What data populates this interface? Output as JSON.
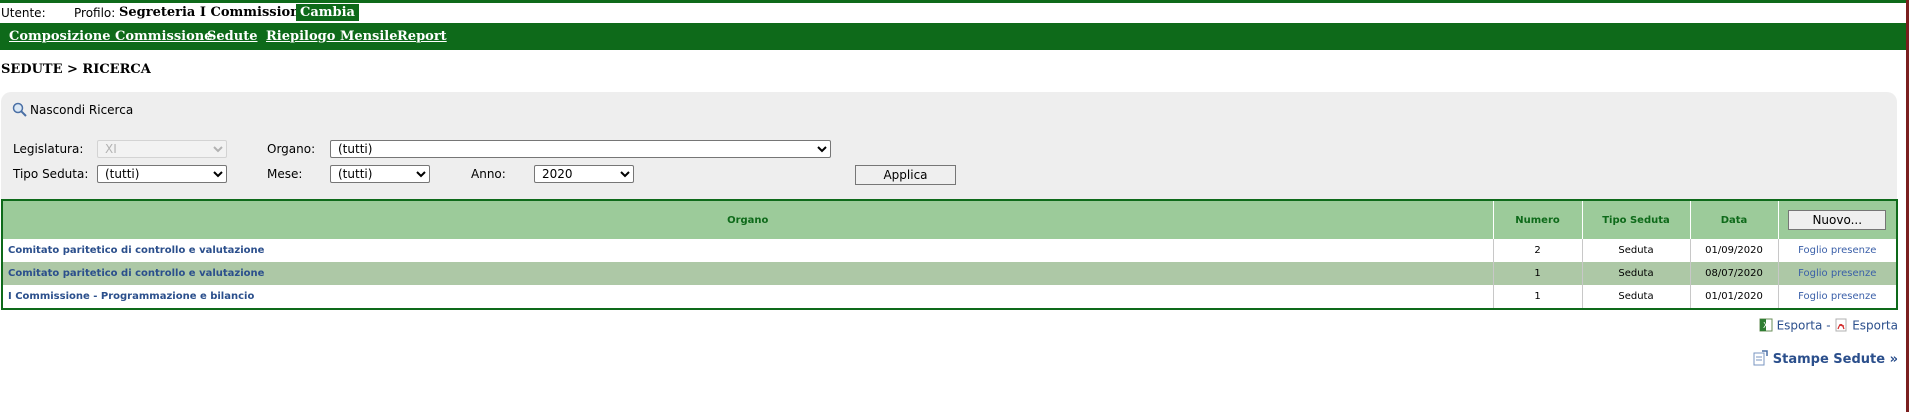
{
  "userbar": {
    "user_label": "Utente:",
    "profile_label": "Profilo:",
    "profile_value": "Segreteria I Commissione",
    "change_label": "Cambia"
  },
  "nav": {
    "items": [
      {
        "label": "Composizione Commissione"
      },
      {
        "label": "Sedute"
      },
      {
        "label": "Riepilogo Mensile"
      },
      {
        "label": "Report"
      }
    ]
  },
  "breadcrumb": "SEDUTE > RICERCA",
  "search": {
    "toggle_label": "Nascondi Ricerca",
    "legislatura_label": "Legislatura:",
    "legislatura_value": "XI",
    "organo_label": "Organo:",
    "organo_value": "(tutti)",
    "tipo_label": "Tipo Seduta:",
    "tipo_value": "(tutti)",
    "mese_label": "Mese:",
    "mese_value": "(tutti)",
    "anno_label": "Anno:",
    "anno_value": "2020",
    "apply_label": "Applica"
  },
  "table": {
    "headers": {
      "organo": "Organo",
      "numero": "Numero",
      "tipo": "Tipo Seduta",
      "data": "Data",
      "new_button": "Nuovo..."
    },
    "rows": [
      {
        "organo": "Comitato paritetico di controllo e valutazione",
        "numero": "2",
        "tipo": "Seduta",
        "data": "01/09/2020",
        "link": "Foglio presenze"
      },
      {
        "organo": "Comitato paritetico di controllo e valutazione",
        "numero": "1",
        "tipo": "Seduta",
        "data": "08/07/2020",
        "link": "Foglio presenze"
      },
      {
        "organo": "I Commissione - Programmazione e bilancio",
        "numero": "1",
        "tipo": "Seduta",
        "data": "01/01/2020",
        "link": "Foglio presenze"
      }
    ]
  },
  "export": {
    "excel_label": "Esporta",
    "separator": "-",
    "pdf_label": "Esporta"
  },
  "stampe_label": "Stampe Sedute »",
  "colors": {
    "brand_green": "#0e6a1a",
    "header_green": "#9ccb9a",
    "alt_row": "#adc8a6",
    "link_blue": "#2b4f8c"
  }
}
